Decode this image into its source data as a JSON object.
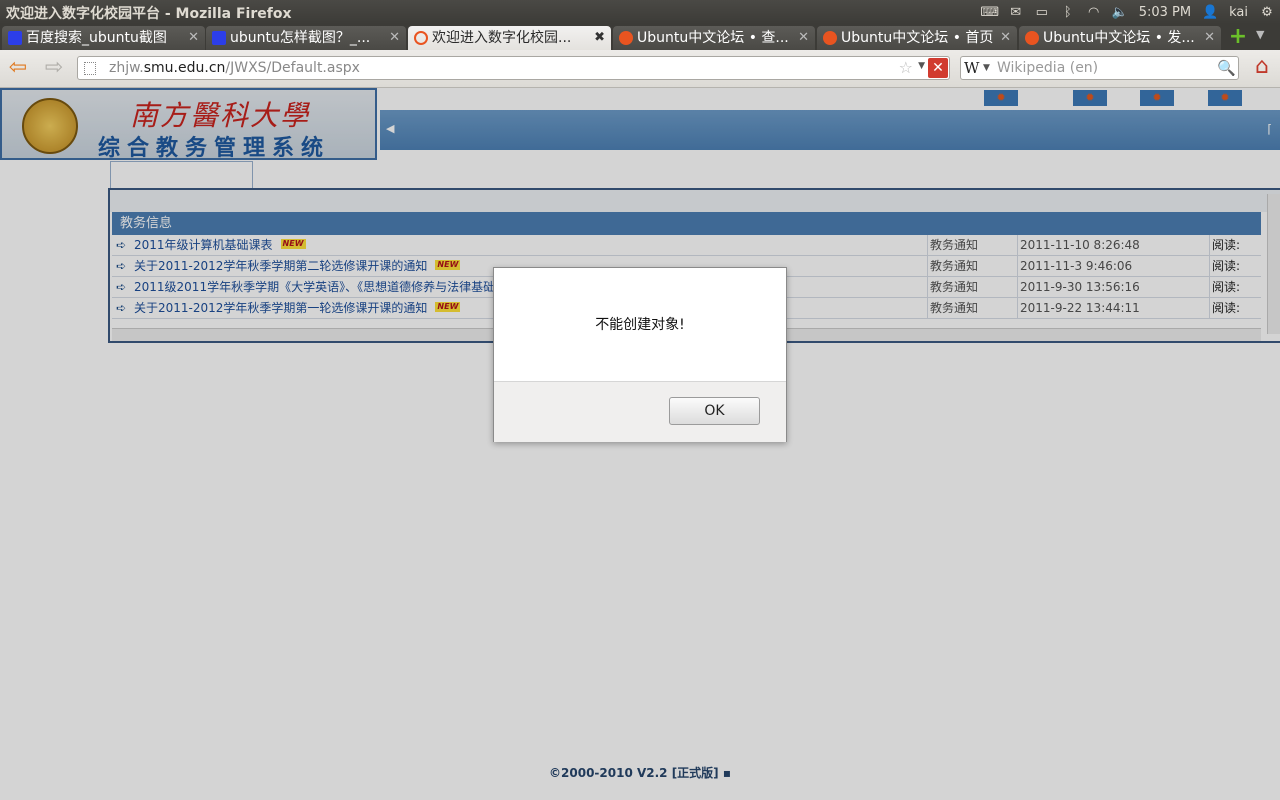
{
  "window": {
    "title": "欢迎进入数字化校园平台 - Mozilla Firefox"
  },
  "system_tray": {
    "time": "5:03 PM",
    "user": "kai"
  },
  "tabs": [
    {
      "label": "百度搜索_ubuntu截图",
      "favicon": "baidu-paw-icon"
    },
    {
      "label": "ubuntu怎样截图？_...",
      "favicon": "baidu-paw-icon"
    },
    {
      "label": "欢迎进入数字化校园...",
      "favicon": "loading-ring-icon",
      "active": true
    },
    {
      "label": "Ubuntu中文论坛 • 查...",
      "favicon": "ubuntu-icon"
    },
    {
      "label": "Ubuntu中文论坛 • 首页",
      "favicon": "ubuntu-icon"
    },
    {
      "label": "Ubuntu中文论坛 • 发...",
      "favicon": "ubuntu-icon"
    }
  ],
  "navbar": {
    "url_prefix": "zhjw.",
    "url_domain": "smu.edu.cn",
    "url_path": "/JWXS/Default.aspx",
    "search_engine": "W",
    "search_placeholder": "Wikipedia (en)"
  },
  "page": {
    "logo_calligraphy": "南方醫科大學",
    "logo_system": "综合教务管理系统",
    "section_header": "教务信息",
    "notices": [
      {
        "title": "2011年级计算机基础课表",
        "new": "NEW",
        "category": "教务通知",
        "date": "2011-11-10 8:26:48",
        "read": "阅读:"
      },
      {
        "title": "关于2011-2012学年秋季学期第二轮选修课开课的通知",
        "new": "NEW",
        "category": "教务通知",
        "date": "2011-11-3 9:46:06",
        "read": "阅读:"
      },
      {
        "title": "2011级2011学年秋季学期《大学英语》、《思想道德修养与法律基础",
        "new": "",
        "category": "教务通知",
        "date": "2011-9-30 13:56:16",
        "read": "阅读:"
      },
      {
        "title": "关于2011-2012学年秋季学期第一轮选修课开课的通知",
        "new": "NEW",
        "category": "教务通知",
        "date": "2011-9-22 13:44:11",
        "read": "阅读:"
      }
    ],
    "footer": "©2000-2010 V2.2 [正式版] ▪"
  },
  "dialog": {
    "message": "不能创建对象!",
    "ok_label": "OK"
  }
}
